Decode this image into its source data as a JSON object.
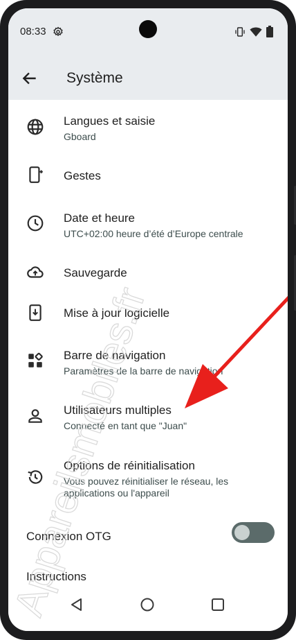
{
  "status": {
    "time": "08:33"
  },
  "appbar": {
    "title": "Système"
  },
  "items": [
    {
      "title": "Langues et saisie",
      "subtitle": "Gboard",
      "icon": "globe-icon"
    },
    {
      "title": "Gestes",
      "icon": "gesture-phone-icon"
    },
    {
      "title": "Date et heure",
      "subtitle": "UTC+02:00 heure d’été d’Europe centrale",
      "icon": "clock-icon"
    },
    {
      "title": "Sauvegarde",
      "icon": "cloud-upload-icon"
    },
    {
      "title": "Mise à jour logicielle",
      "icon": "system-update-icon"
    },
    {
      "title": "Barre de navigation",
      "subtitle": "Paramètres de la barre de navigation",
      "icon": "navigation-bar-icon"
    },
    {
      "title": "Utilisateurs multiples",
      "subtitle": "Connecté en tant que \"Juan\"",
      "icon": "person-icon"
    },
    {
      "title": "Options de réinitialisation",
      "subtitle": "Vous pouvez réinitialiser le réseau, les applications ou l'appareil",
      "icon": "history-icon"
    }
  ],
  "otg": {
    "label": "Connexion OTG",
    "enabled": false
  },
  "instructions": {
    "label": "Instructions"
  },
  "watermark": "Appareilsmobiles.fr",
  "colors": {
    "bar_bg": "#e9ecef",
    "arrow": "#e8201c",
    "toggle_track": "#5b6b6a"
  }
}
